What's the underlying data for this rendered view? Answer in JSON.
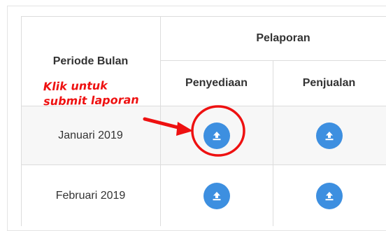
{
  "table": {
    "header": {
      "period_label": "Periode Bulan",
      "group_label": "Pelaporan",
      "col1_label": "Penyediaan",
      "col2_label": "Penjualan"
    },
    "rows": [
      {
        "period": "Januari 2019"
      },
      {
        "period": "Februari 2019"
      }
    ]
  },
  "icons": {
    "upload": "upload-icon"
  },
  "annotation": {
    "line1": "Klik untuk",
    "line2": "submit laporan",
    "color": "#ee1111"
  },
  "colors": {
    "button": "#3d8fe0",
    "row_alt": "#f7f7f7",
    "border": "#dcdcdc"
  }
}
